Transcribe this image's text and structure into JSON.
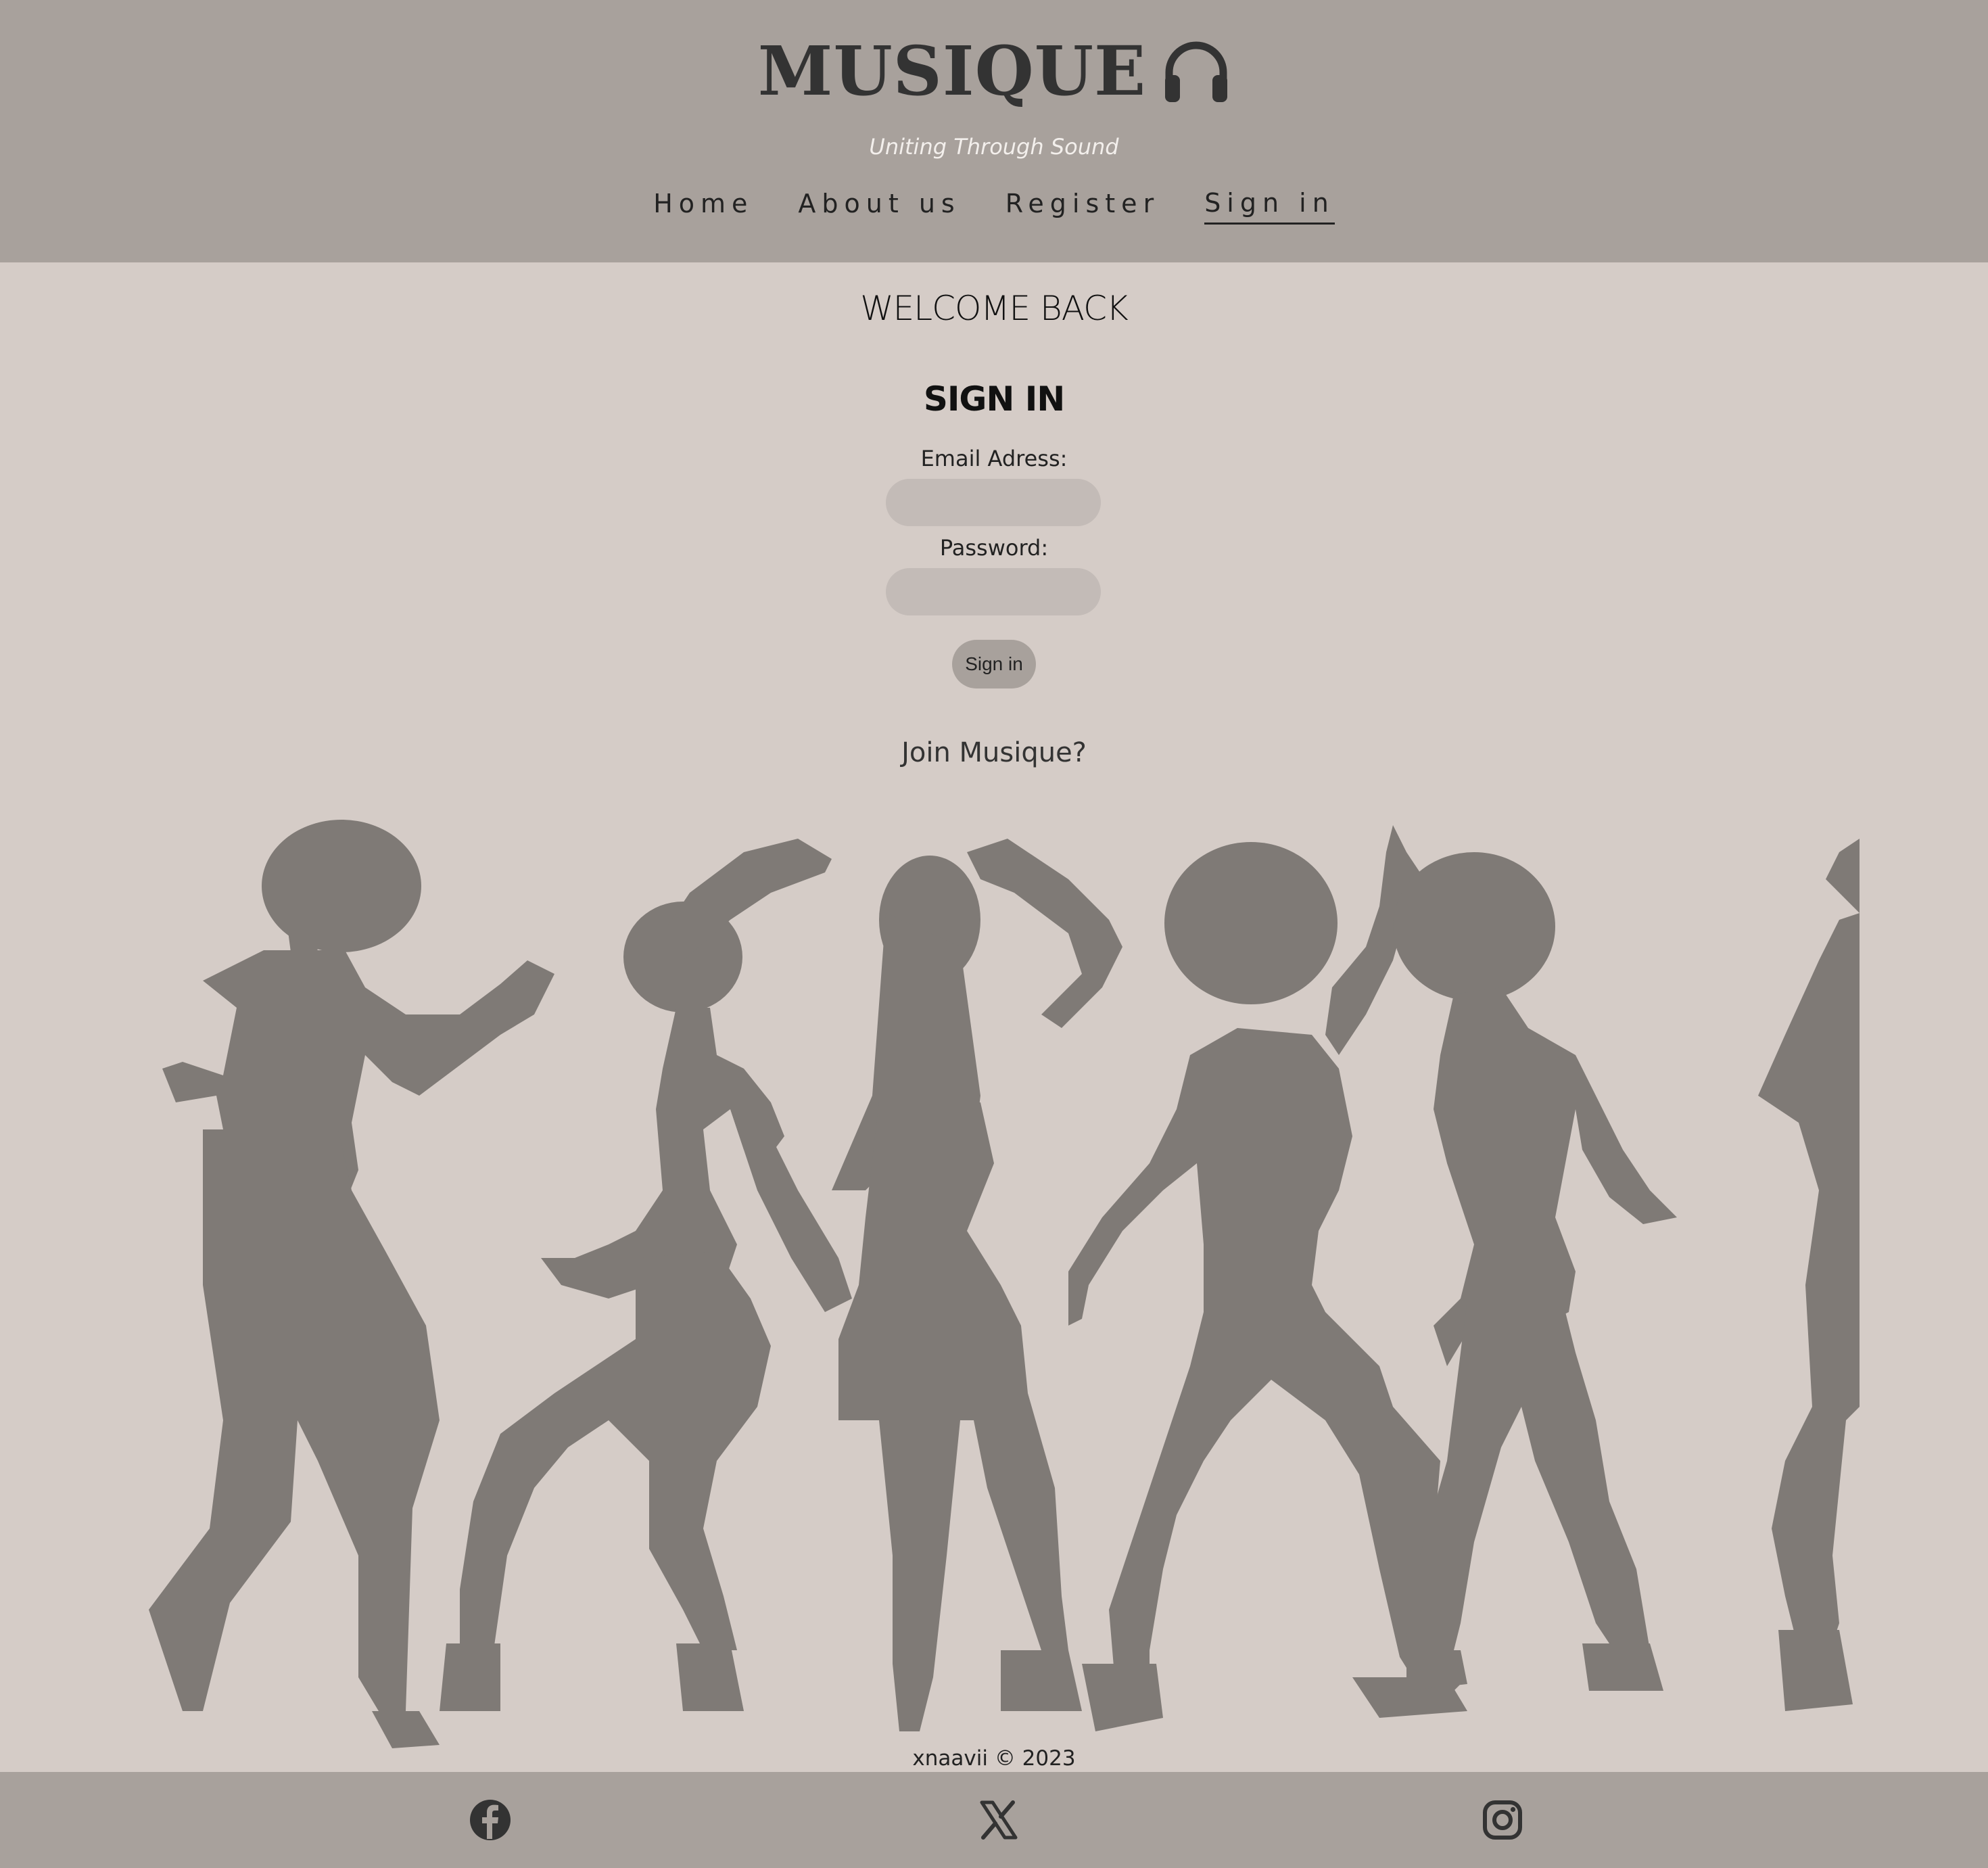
{
  "header": {
    "brand": "MUSIQUE",
    "brand_icon": "headphones-icon",
    "tagline": "Uniting Through Sound",
    "nav": [
      {
        "label": "Home",
        "active": false
      },
      {
        "label": "About us",
        "active": false
      },
      {
        "label": "Register",
        "active": false
      },
      {
        "label": "Sign in",
        "active": true
      }
    ]
  },
  "main": {
    "welcome": "WELCOME BACK",
    "form_title": "SIGN IN",
    "email_label": "Email Adress:",
    "email_value": "",
    "password_label": "Password:",
    "password_value": "",
    "submit_label": "Sign in",
    "join_link": "Join Musique?",
    "illustration": "dancing-silhouettes"
  },
  "footer": {
    "copyright": "xnaavii © 2023",
    "social_icons": [
      "facebook-icon",
      "x-icon",
      "instagram-icon"
    ]
  },
  "colors": {
    "header_bg": "#a8a19c",
    "page_bg": "#d5ccc7",
    "input_bg": "#c3bbb7",
    "silhouette": "#7f7a76",
    "brand_text": "#333333",
    "tagline": "#f3efec"
  }
}
